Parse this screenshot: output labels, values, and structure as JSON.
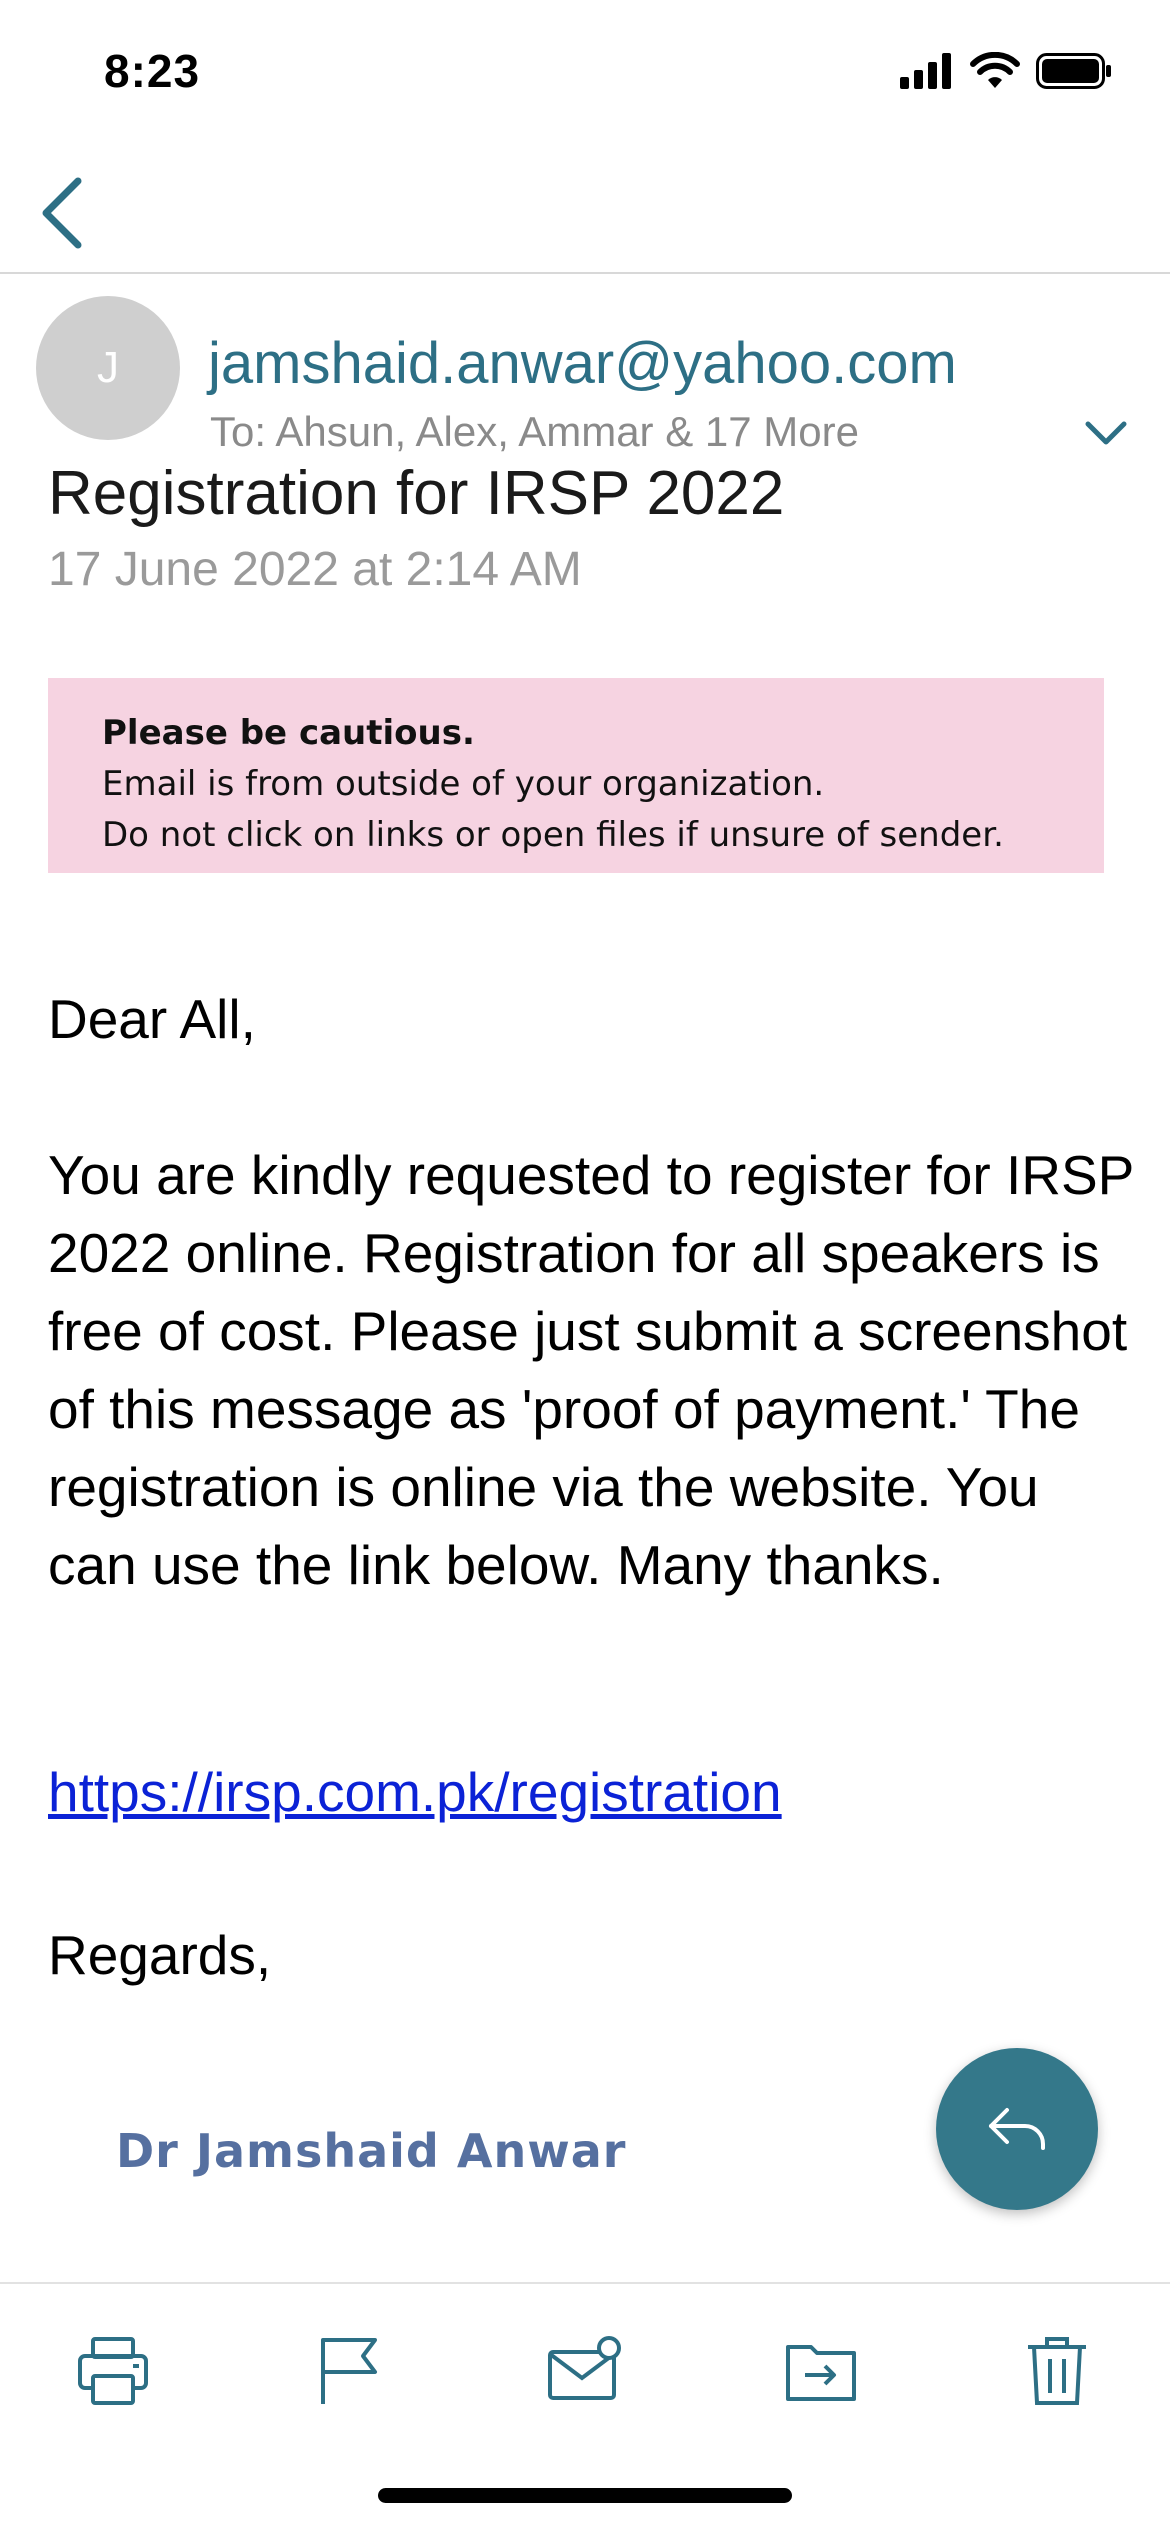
{
  "status_bar": {
    "time": "8:23"
  },
  "header": {
    "avatar_initial": "J",
    "sender_email": "jamshaid.anwar@yahoo.com",
    "recipients": "To: Ahsun, Alex, Ammar & 17 More",
    "subject": "Registration for IRSP 2022",
    "date": "17 June 2022 at 2:14 AM"
  },
  "caution_banner": {
    "title": "Please be cautious.",
    "line1": "Email is from outside of your organization.",
    "line2": "Do not click on links or open files if unsure of sender."
  },
  "body": {
    "greeting": "Dear All,",
    "paragraph": "You are kindly requested to register for IRSP 2022 online. Registration for all speakers is free of cost. Please just submit a screenshot of this message as 'proof of payment.' The registration is online via the website. You can use the link below. Many thanks.",
    "link": "https://irsp.com.pk/registration",
    "closing": "Regards,",
    "signature": "Dr Jamshaid Anwar"
  },
  "toolbar": {
    "items": [
      "print-icon",
      "flag-icon",
      "mail-unread-icon",
      "move-to-folder-icon",
      "trash-icon"
    ]
  },
  "colors": {
    "accent": "#2d6f85",
    "fab": "#34788a",
    "caution_bg": "#f6d3e1",
    "link": "#0b22d6",
    "signature": "#5670a0"
  }
}
